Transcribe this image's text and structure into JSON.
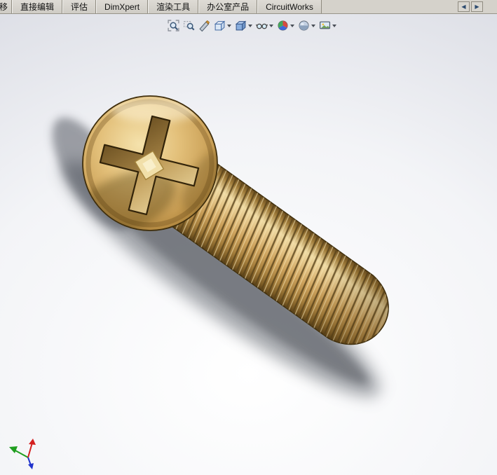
{
  "tab_bar": {
    "tabs": [
      {
        "label": "移"
      },
      {
        "label": "直接编辑"
      },
      {
        "label": "评估"
      },
      {
        "label": "DimXpert"
      },
      {
        "label": "渲染工具"
      },
      {
        "label": "办公室产品"
      },
      {
        "label": "CircuitWorks"
      }
    ],
    "left_button_glyph": "◀",
    "right_button_glyph": "▶"
  },
  "heads_up_toolbar": {
    "buttons": [
      {
        "name": "zoom-to-fit",
        "dropdown": false
      },
      {
        "name": "zoom-to-area",
        "dropdown": false
      },
      {
        "name": "section-view",
        "dropdown": false
      },
      {
        "name": "view-orientation",
        "dropdown": true
      },
      {
        "name": "display-style",
        "dropdown": true
      },
      {
        "name": "hide-show-items",
        "dropdown": true
      },
      {
        "name": "edit-appearance",
        "dropdown": true
      },
      {
        "name": "apply-scene",
        "dropdown": true
      },
      {
        "name": "view-settings",
        "dropdown": true
      }
    ]
  },
  "viewport": {
    "background_top": "#c6c9d4",
    "background_bottom": "#ffffff",
    "screw_gold_highlight": "#eed9a2",
    "screw_gold_mid": "#cda25c",
    "screw_gold_dark": "#66491c",
    "shadow_color": "#4e535c"
  },
  "orientation_triad": {
    "x_axis_color": "#d42020",
    "y_axis_color": "#1f9e1f",
    "z_axis_color": "#2033cc"
  }
}
